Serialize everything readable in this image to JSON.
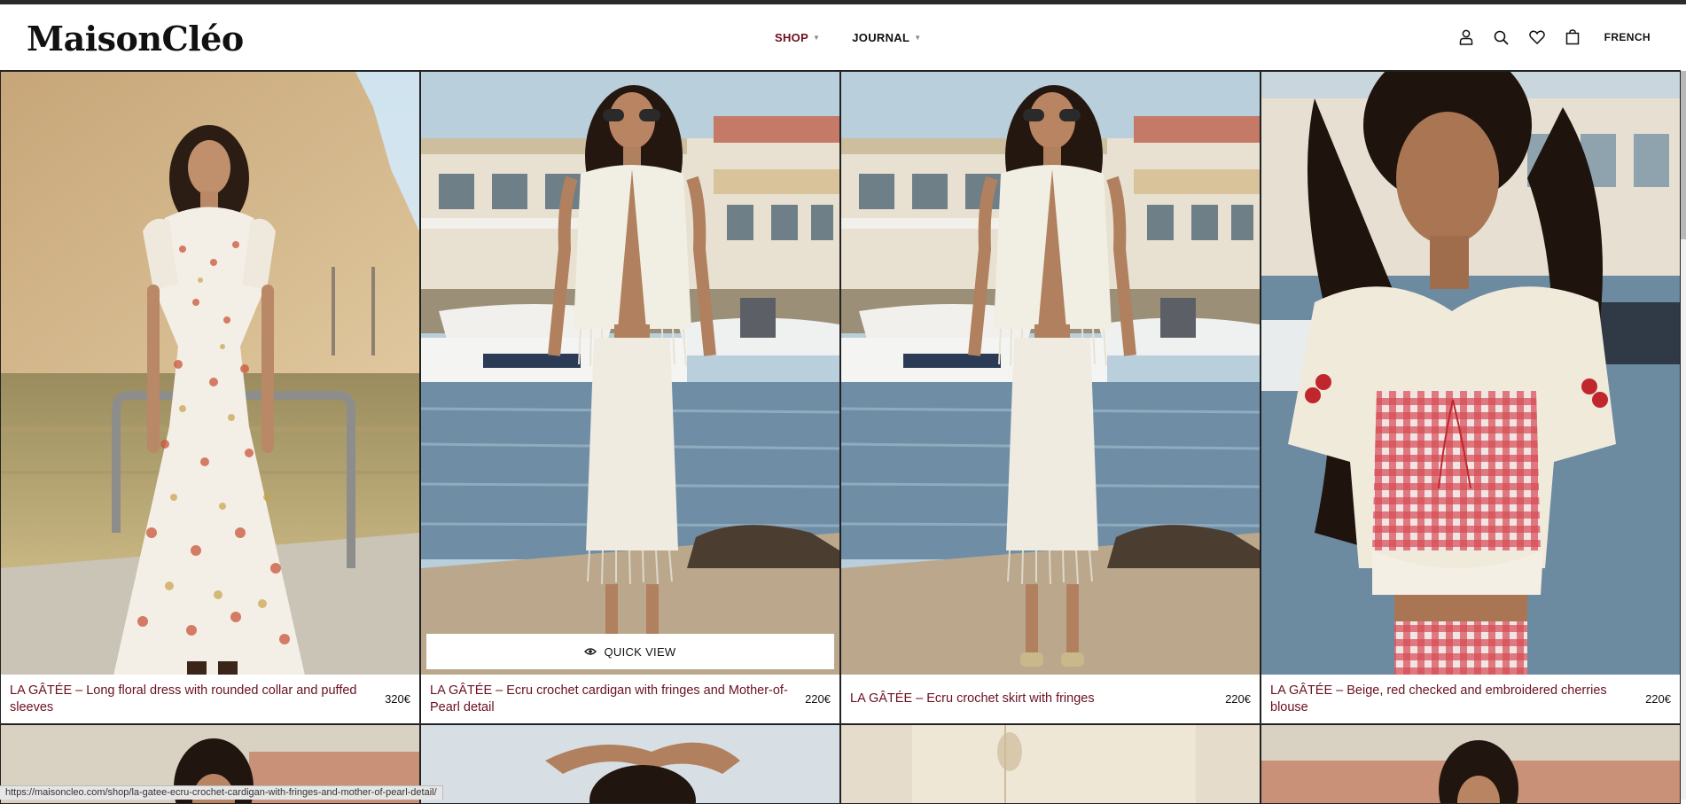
{
  "brand": {
    "logo": "MaisonCléo"
  },
  "nav": {
    "items": [
      {
        "label": "SHOP",
        "active": true
      },
      {
        "label": "JOURNAL",
        "active": false
      }
    ]
  },
  "header_icons": [
    "account-icon",
    "search-icon",
    "wishlist-heart-icon",
    "cart-bag-icon"
  ],
  "language": "FRENCH",
  "colors": {
    "accent": "#6b1020",
    "text": "#111111",
    "border": "#222222"
  },
  "products": [
    {
      "title": "LA GÂTÉE – Long floral dress with rounded collar and puffed sleeves",
      "price": "320€"
    },
    {
      "title": "LA GÂTÉE – Ecru crochet cardigan with fringes and Mother-of-Pearl detail",
      "price": "220€"
    },
    {
      "title": "LA GÂTÉE – Ecru crochet skirt with fringes",
      "price": "220€"
    },
    {
      "title": "LA GÂTÉE – Beige, red checked and embroidered cherries blouse",
      "price": "220€"
    }
  ],
  "quick_view": {
    "label": "QUICK VIEW"
  },
  "status_url": "https://maisoncleo.com/shop/la-gatee-ecru-crochet-cardigan-with-fringes-and-mother-of-pearl-detail/"
}
